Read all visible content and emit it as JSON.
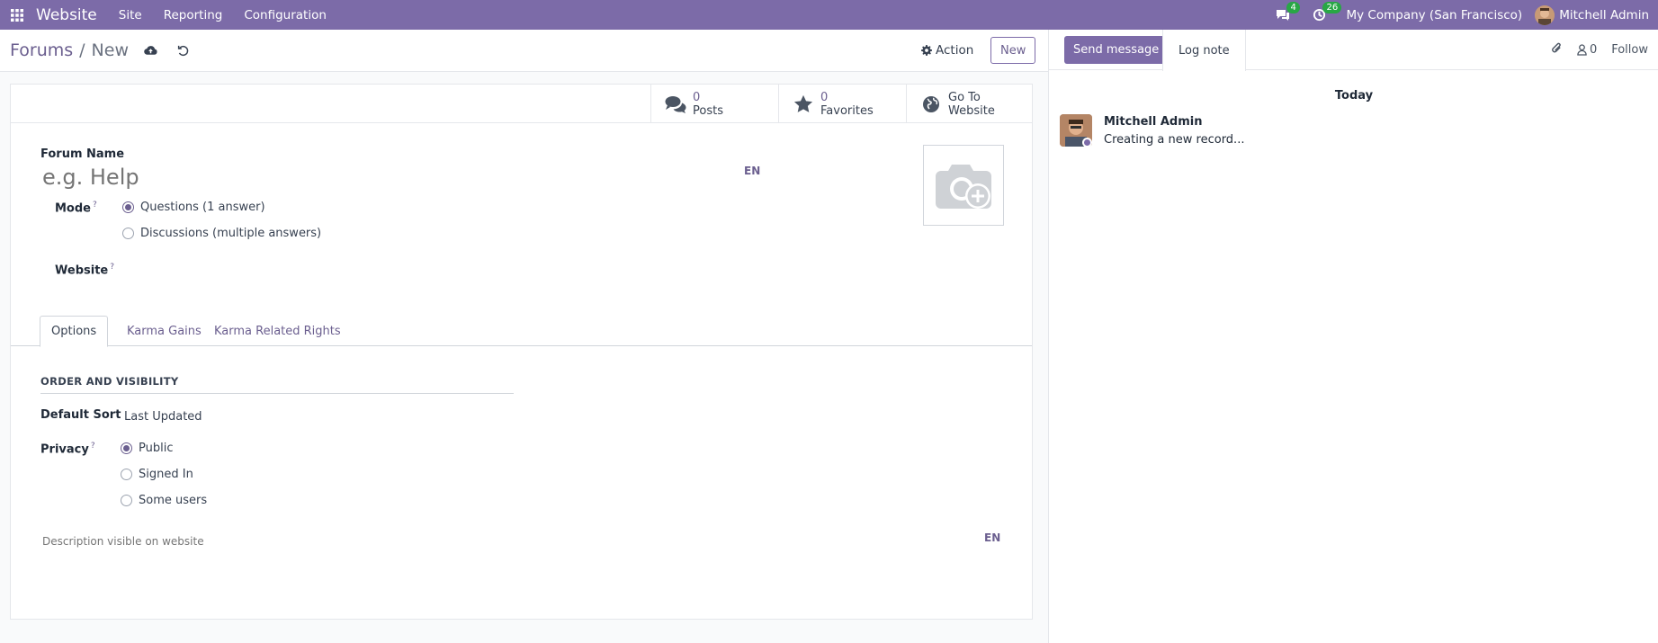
{
  "navbar": {
    "app_name": "Website",
    "menu": [
      "Site",
      "Reporting",
      "Configuration"
    ],
    "messages_count": "4",
    "activities_count": "26",
    "company": "My Company (San Francisco)",
    "user": "Mitchell Admin"
  },
  "control": {
    "breadcrumb_parent": "Forums",
    "breadcrumb_sep": "/",
    "breadcrumb_current": "New",
    "action_label": "Action",
    "new_label": "New"
  },
  "stats": {
    "posts_value": "0",
    "posts_label": "Posts",
    "favorites_value": "0",
    "favorites_label": "Favorites",
    "website_line1": "Go To",
    "website_line2": "Website"
  },
  "form": {
    "forum_name_label": "Forum Name",
    "forum_name_placeholder": "e.g. Help",
    "lang": "EN",
    "mode_label": "Mode",
    "help_mark": "?",
    "mode_options": [
      "Questions (1 answer)",
      "Discussions (multiple answers)"
    ],
    "mode_selected": 0,
    "website_label": "Website"
  },
  "tabs": [
    "Options",
    "Karma Gains",
    "Karma Related Rights"
  ],
  "active_tab": 0,
  "options": {
    "section_title": "ORDER AND VISIBILITY",
    "default_sort_label": "Default Sort",
    "default_sort_value": "Last Updated",
    "privacy_label": "Privacy",
    "privacy_options": [
      "Public",
      "Signed In",
      "Some users"
    ],
    "privacy_selected": 0,
    "description_placeholder": "Description visible on website",
    "lang": "EN"
  },
  "chatter": {
    "send_message": "Send message",
    "log_note": "Log note",
    "followers_count": "0",
    "follow": "Follow",
    "date_separator": "Today",
    "author": "Mitchell Admin",
    "message": "Creating a new record..."
  },
  "colors": {
    "brand": "#7c6ba8",
    "link": "#6b5f8f",
    "badge": "#28a745"
  }
}
